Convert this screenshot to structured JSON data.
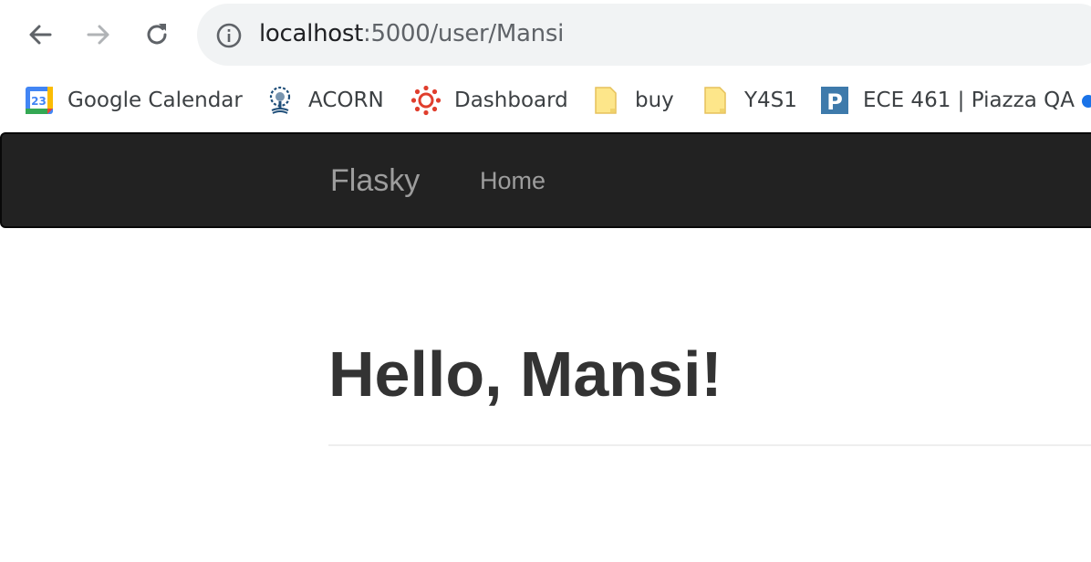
{
  "browser": {
    "url_host": "localhost",
    "url_rest": ":5000/user/Mansi",
    "icons": {
      "back": "arrow-left-icon",
      "forward": "arrow-right-icon",
      "reload": "reload-icon",
      "info": "info-icon"
    }
  },
  "bookmarks": [
    {
      "label": "Google Calendar",
      "icon": "google-calendar-icon",
      "badge": "23"
    },
    {
      "label": "ACORN",
      "icon": "acorn-tree-icon"
    },
    {
      "label": "Dashboard",
      "icon": "canvas-icon"
    },
    {
      "label": "buy",
      "icon": "folder-icon"
    },
    {
      "label": "Y4S1",
      "icon": "folder-icon"
    },
    {
      "label": "ECE 461 | Piazza QA",
      "icon": "piazza-icon",
      "badge": "P"
    }
  ],
  "navbar": {
    "brand": "Flasky",
    "home": "Home"
  },
  "main": {
    "greeting": "Hello, Mansi!"
  },
  "colors": {
    "navbar_bg": "#222222",
    "navbar_text": "#9d9d9d",
    "heading": "#333333",
    "omnibox_bg": "#f1f3f4"
  }
}
